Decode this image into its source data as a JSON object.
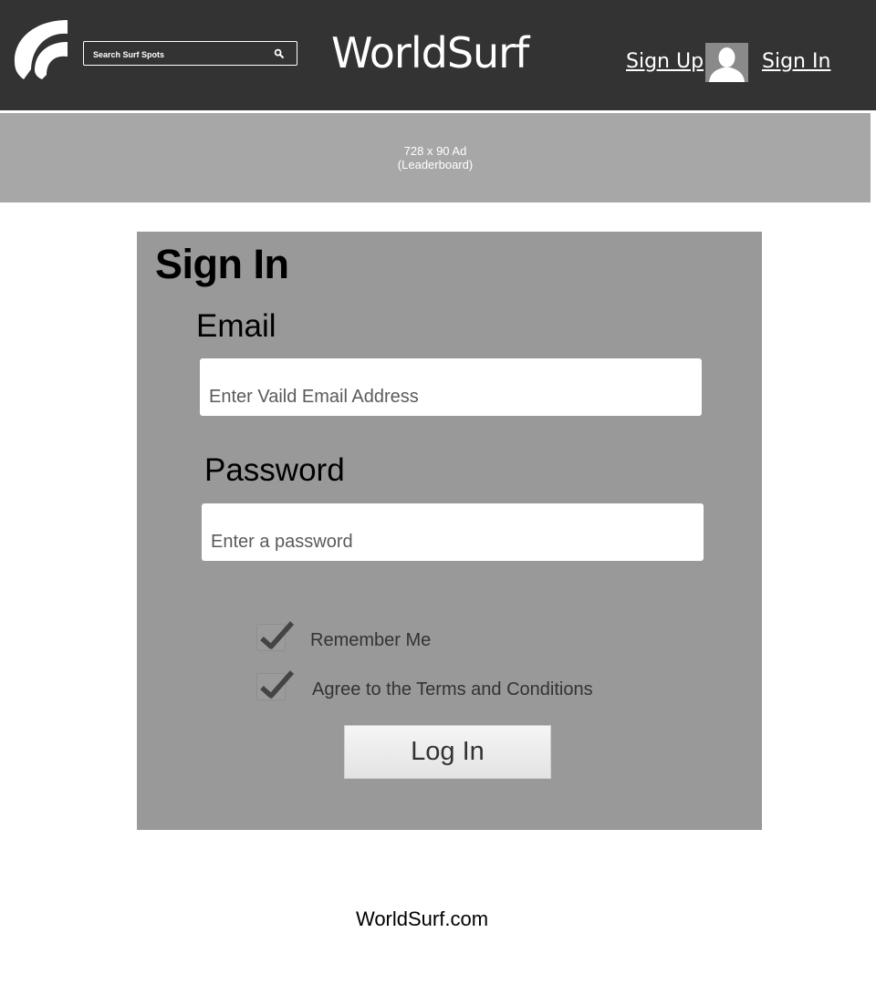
{
  "header": {
    "logo_icon": "wave-logo-icon",
    "search": {
      "placeholder": "Search Surf Spots",
      "icon": "search-icon"
    },
    "site_title": "WorldSurf",
    "nav": {
      "signup_label": "Sign Up",
      "signin_label": "Sign In",
      "avatar_icon": "user-avatar-icon"
    }
  },
  "ad": {
    "size_label": "728 x 90 Ad",
    "type_label": "(Leaderboard)"
  },
  "signin_form": {
    "title": "Sign In",
    "email": {
      "label": "Email",
      "placeholder": "Enter Vaild Email Address"
    },
    "password": {
      "label": "Password",
      "placeholder": "Enter a password"
    },
    "checkboxes": [
      {
        "label": "Remember Me",
        "checked": true
      },
      {
        "label": "Agree to the Terms and Conditions",
        "checked": true
      }
    ],
    "submit_label": "Log In"
  },
  "footer": {
    "text": "WorldSurf.com"
  },
  "colors": {
    "header_bg": "#333333",
    "ad_bg": "#a7a7a7",
    "panel_bg": "#999999",
    "page_bg": "#ffffff"
  }
}
